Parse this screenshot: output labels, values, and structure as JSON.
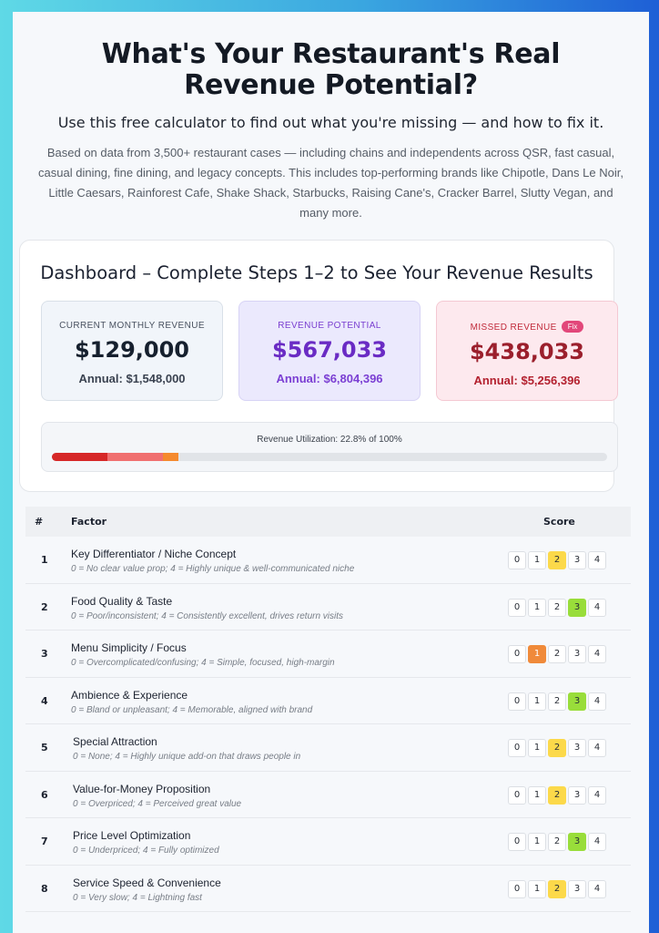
{
  "hero": {
    "title": "What's Your Restaurant's Real Revenue Potential?",
    "subtitle": "Use this free calculator to find out what you're missing — and how to fix it.",
    "description": "Based on data from 3,500+ restaurant cases — including chains and independents across QSR, fast casual, casual dining, fine dining, and legacy concepts. This includes top-performing brands like Chipotle, Dans Le Noir, Little Caesars, Rainforest Cafe, Shake Shack, Starbucks, Raising Cane's, Cracker Barrel, Slutty Vegan, and many more."
  },
  "dashboard": {
    "title": "Dashboard – Complete Steps 1–2 to See Your Revenue Results",
    "cards": {
      "current": {
        "label": "CURRENT MONTHLY REVENUE",
        "value": "$129,000",
        "annual": "Annual: $1,548,000"
      },
      "potential": {
        "label": "REVENUE POTENTIAL",
        "value": "$567,033",
        "annual": "Annual: $6,804,396"
      },
      "missed": {
        "label": "MISSED REVENUE",
        "badge": "Fix",
        "value": "$438,033",
        "annual": "Annual: $5,256,396"
      }
    },
    "utilization": {
      "label": "Revenue Utilization: 22.8% of 100%",
      "percent": 22.8,
      "segments": [
        {
          "fraction": 0.1,
          "color": "#d62828"
        },
        {
          "fraction": 0.1,
          "color": "#f07070"
        },
        {
          "fraction": 0.028,
          "color": "#f58a2e"
        }
      ]
    }
  },
  "colors": {
    "score_mid": "#fcd94a",
    "score_high": "#99dd3a",
    "score_low": "#f08a3a"
  },
  "table": {
    "headers": {
      "num": "#",
      "factor": "Factor",
      "score": "Score"
    },
    "score_options": [
      "0",
      "1",
      "2",
      "3",
      "4"
    ],
    "rows": [
      {
        "num": "1",
        "name": "Key Differentiator / Niche Concept",
        "desc": "0 = No clear value prop; 4 = Highly unique & well-communicated niche",
        "selected": 2
      },
      {
        "num": "2",
        "name": "Food Quality & Taste",
        "desc": "0 = Poor/inconsistent; 4 = Consistently excellent, drives return visits",
        "selected": 3
      },
      {
        "num": "3",
        "name": "Menu Simplicity / Focus",
        "desc": "0 = Overcomplicated/confusing; 4 = Simple, focused, high-margin",
        "selected": 1
      },
      {
        "num": "4",
        "name": "Ambience & Experience",
        "desc": "0 = Bland or unpleasant; 4 = Memorable, aligned with brand",
        "selected": 3
      },
      {
        "num": "5",
        "name": "Special Attraction",
        "desc": "0 = None; 4 = Highly unique add-on that draws people in",
        "selected": 2
      },
      {
        "num": "6",
        "name": "Value-for-Money Proposition",
        "desc": "0 = Overpriced; 4 = Perceived great value",
        "selected": 2
      },
      {
        "num": "7",
        "name": "Price Level Optimization",
        "desc": "0 = Underpriced; 4 = Fully optimized",
        "selected": 3
      },
      {
        "num": "8",
        "name": "Service Speed & Convenience",
        "desc": "0 = Very slow; 4 = Lightning fast",
        "selected": 2
      }
    ]
  }
}
